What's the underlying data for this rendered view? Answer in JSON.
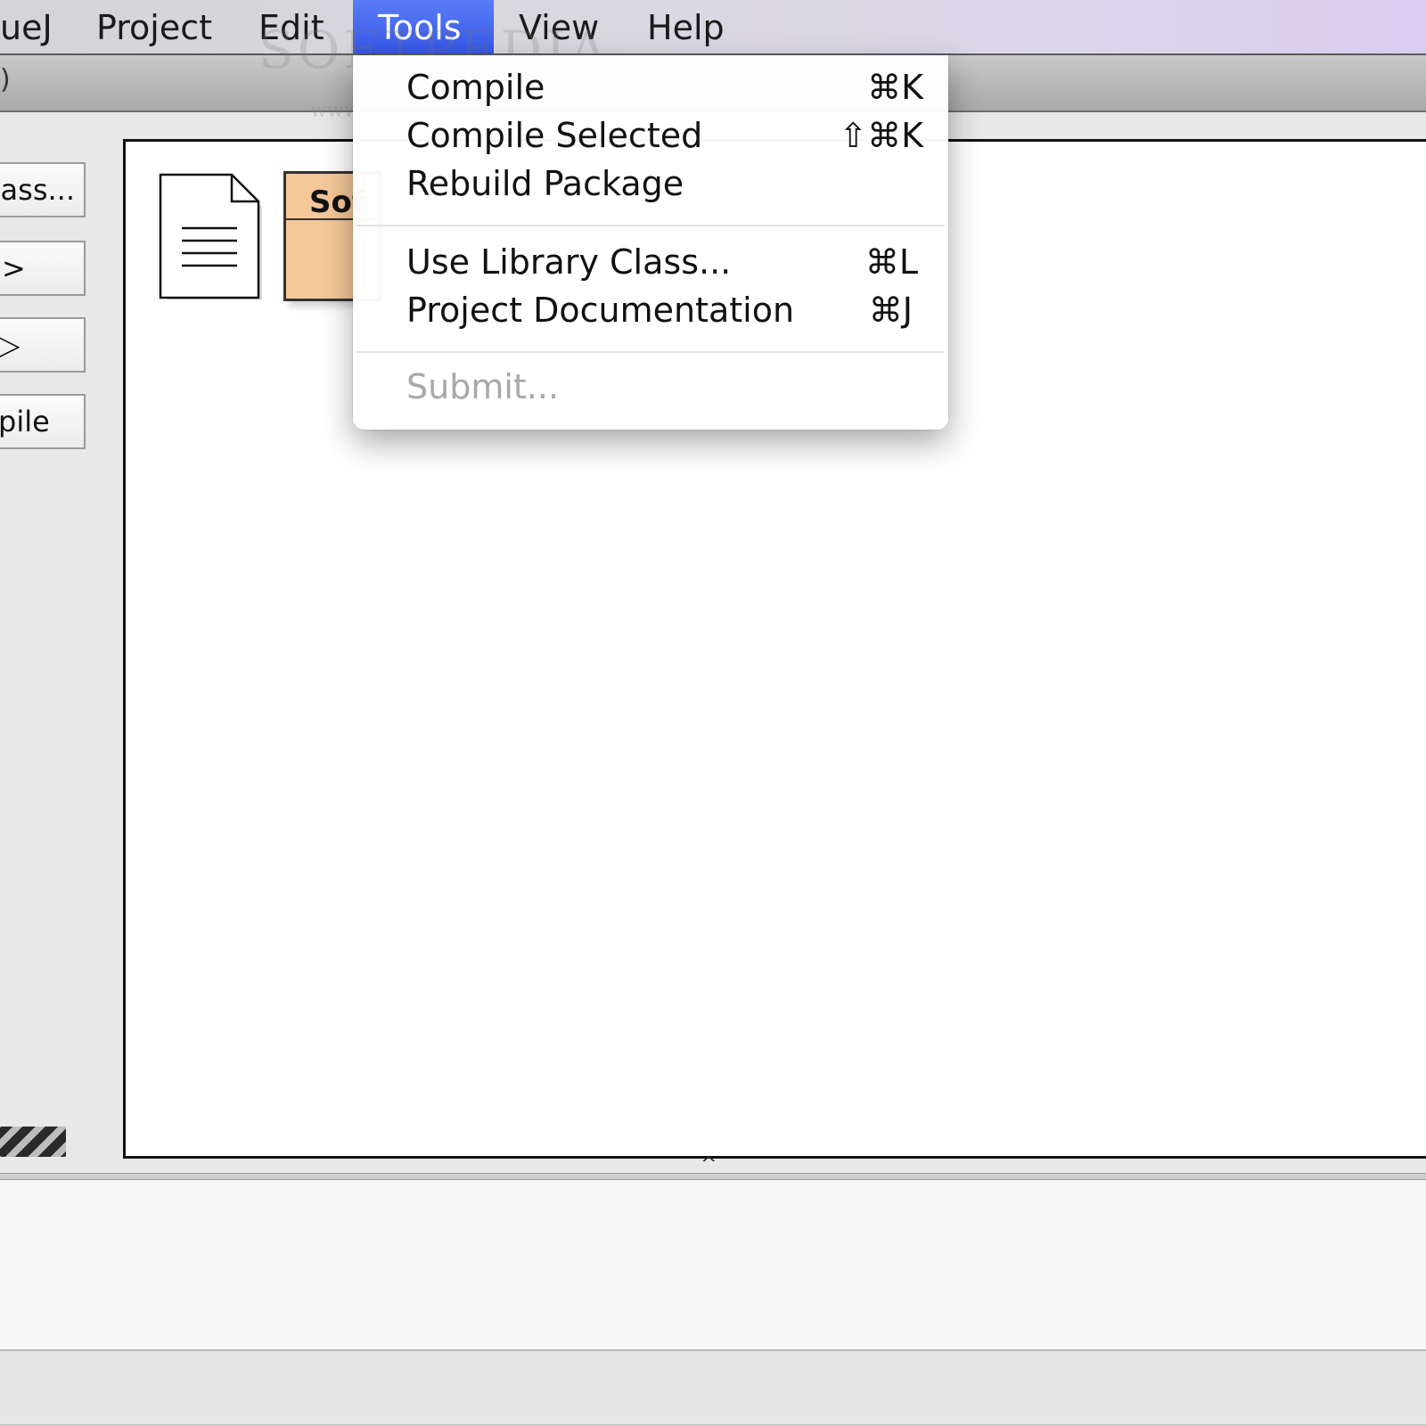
{
  "menubar": {
    "app_name": "ueJ",
    "items": [
      "Project",
      "Edit",
      "Tools",
      "View",
      "Help"
    ],
    "active": "Tools",
    "watermark_big": "SOFTPEDIA",
    "watermark_small": "www.softpedia.com"
  },
  "sidebar": {
    "buttons": [
      "ass...",
      ">",
      "▷",
      "pile"
    ]
  },
  "diagram": {
    "class_name": "Sof"
  },
  "tools_menu": {
    "items": [
      {
        "label": "Compile",
        "shortcut": "⌘K"
      },
      {
        "label": "Compile Selected",
        "shortcut": "⇧⌘K"
      },
      {
        "label": "Rebuild Package",
        "shortcut": ""
      },
      {
        "label": "Use Library Class...",
        "shortcut": "⌘L"
      },
      {
        "label": "Project Documentation",
        "shortcut": "⌘J"
      },
      {
        "label": "Submit...",
        "shortcut": ""
      }
    ]
  },
  "colors": {
    "menu_highlight": "#3d5ff0",
    "class_fill": "#f5c89a",
    "disabled_text": "#a8a8a8"
  }
}
